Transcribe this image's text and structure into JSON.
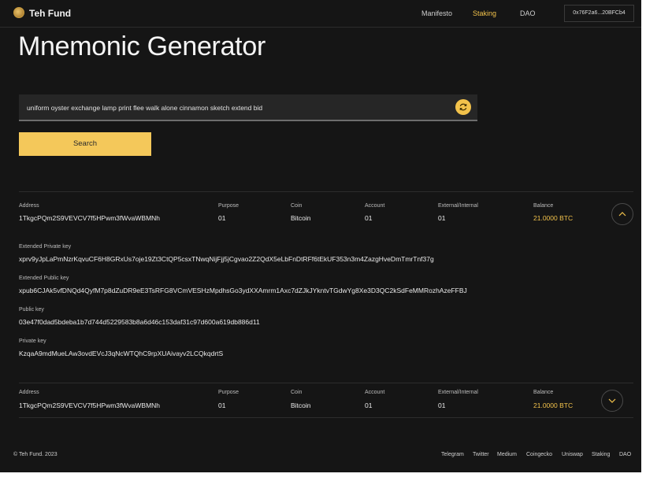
{
  "header": {
    "brand": "Teh Fund",
    "nav": [
      "Manifesto",
      "Staking",
      "DAO"
    ],
    "wallet": "0x76F2a6...20BFCb4"
  },
  "page_title": "Mnemonic Generator",
  "search": {
    "value": "uniform oyster exchange lamp print flee walk alone cinnamon sketch extend bid",
    "button": "Search"
  },
  "columns": [
    "Address",
    "Purpose",
    "Coin",
    "Account",
    "External/Internal",
    "Balance"
  ],
  "results": [
    {
      "address": "1TkgcPQm2S9VEVCV7f5HPwm3fWvaWBMNh",
      "purpose": "01",
      "coin": "Bitcoin",
      "account": "01",
      "ext_int": "01",
      "balance": "21.0000 BTC",
      "details": [
        {
          "label": "Extended Private key",
          "value": "xprv9yJpLaPmNzrKqvuCF6H8GRxUs7oje19Zt3CtQP5csxTNwqNijFjj5jCgvao2Z2QdX5eLbFnDtRFf6tEkUF353n3m4ZazgHveDmTmrTnf37g"
        },
        {
          "label": "Extended  Public key",
          "value": "xpub6CJAk5vfDNQd4QyfM7p8dZuDR9eE3TsRFG8VCmVESHzMpdhsGo3ydXXAmrm1Axc7dZJkJYkntvTGdwYg8Xe3D3QC2kSdFeMMRozhAzeFFBJ"
        },
        {
          "label": "Public key",
          "value": "03e47f0dad5bdeba1b7d744d5229583b8a6d46c153daf31c97d600a619db886d11"
        },
        {
          "label": "Private key",
          "value": "KzqaA9mdMueLAw3ovdEVcJ3qNcWTQhC9rpXUAivayv2LCQkqdrtS"
        }
      ]
    },
    {
      "address": "1TkgcPQm2S9VEVCV7f5HPwm3fWvaWBMNh",
      "purpose": "01",
      "coin": "Bitcoin",
      "account": "01",
      "ext_int": "01",
      "balance": "21.0000 BTC"
    }
  ],
  "footer": {
    "copyright": "© Teh Fund. 2023",
    "links": [
      "Telegram",
      "Twitter",
      "Medium",
      "Coingecko",
      "Uniswap",
      "Staking",
      "DAO"
    ]
  },
  "colors": {
    "accent": "#f2c24b",
    "background": "#151515",
    "field": "#262626"
  },
  "icons": [
    "logo-coin-icon",
    "refresh-icon",
    "chevron-up-icon",
    "chevron-down-icon"
  ]
}
